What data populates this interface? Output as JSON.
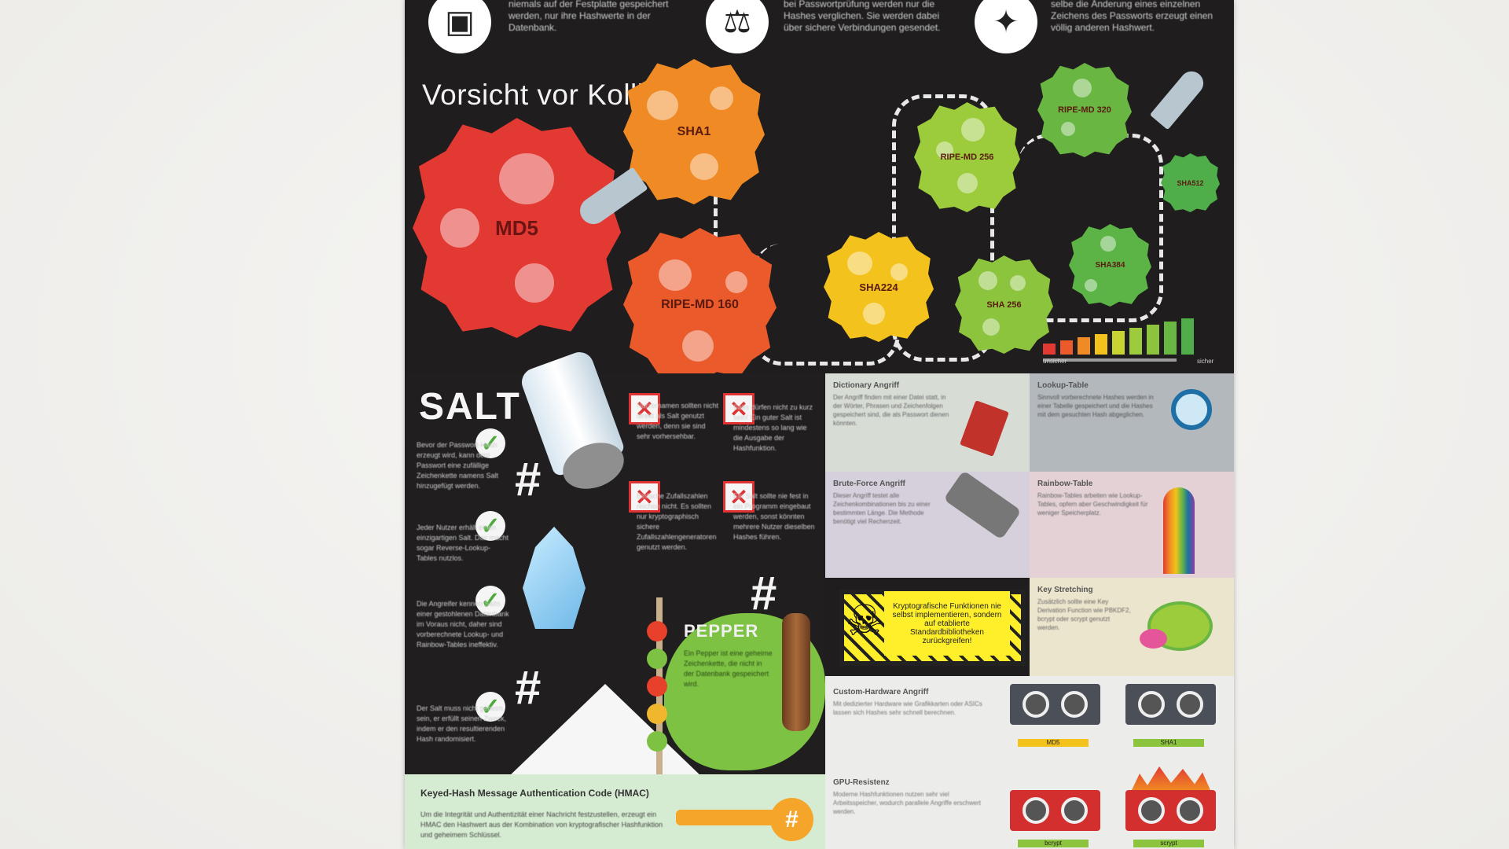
{
  "poster": {
    "section_title": "Vorsicht vor Kollisionen",
    "header_texts": [
      "niemals auf der Festplatte gespeichert werden, nur ihre Hashwerte in der Datenbank.",
      "bei Passwortprüfung werden nur die Hashes verglichen. Sie werden dabei über sichere Verbindungen gesendet.",
      "selbe die Änderung eines einzelnen Zeichens des Passworts erzeugt einen völlig anderen Hashwert."
    ],
    "header_icons": [
      "hard-drive-icon",
      "scales-icon",
      "stamp-icon"
    ],
    "hashes": [
      {
        "label": "MD5",
        "color": "#e23a33"
      },
      {
        "label": "SHA1",
        "color": "#f08a24"
      },
      {
        "label": "RIPE-MD 160",
        "color": "#ea5a2a"
      },
      {
        "label": "SHA224",
        "color": "#f3c21c"
      },
      {
        "label": "RIPE-MD 256",
        "color": "#9ccb3b"
      },
      {
        "label": "SHA 256",
        "color": "#8cc43d"
      },
      {
        "label": "RIPE-MD 320",
        "color": "#6ab643"
      },
      {
        "label": "SHA384",
        "color": "#5cb346"
      },
      {
        "label": "SHA512",
        "color": "#4fae4a"
      }
    ],
    "scale": {
      "left_label": "unsicher",
      "right_label": "sicher"
    },
    "salt": {
      "title": "SALT",
      "checks": [
        "Bevor der Passwort-Hash erzeugt wird, kann dem Passwort eine zufällige Zeichenkette namens Salt hinzugefügt werden.",
        "Jeder Nutzer erhält einen einzigartigen Salt. Das macht sogar Reverse-Lookup-Tables nutzlos.",
        "Die Angreifer kennen Salts einer gestohlenen Datenbank im Voraus nicht, daher sind vorberechnete Lookup- und Rainbow-Tables ineffektiv.",
        "Der Salt muss nicht geheim sein, er erfüllt seinen Zweck, indem er den resultierenden Hash randomisiert."
      ],
      "crosses": [
        "Nutzernamen sollten nicht direkt als Salt genutzt werden, denn sie sind sehr vorhersehbar.",
        "Salts dürfen nicht zu kurz sein! Ein guter Salt ist mindestens so lang wie die Ausgabe der Hashfunktion.",
        "Einfache Zufallszahlen reichen nicht. Es sollten nur kryptographisch sichere Zufallszahlengeneratoren genutzt werden.",
        "Ein Salt sollte nie fest in ein Programm eingebaut werden, sonst könnten mehrere Nutzer dieselben Hashes führen."
      ]
    },
    "pepper": {
      "title": "PEPPER",
      "text": "Ein Pepper ist eine geheime Zeichenkette, die nicht in der Datenbank gespeichert wird."
    },
    "hmac": {
      "title": "Keyed-Hash Message Authentication Code (HMAC)",
      "text": "Um die Integrität und Authentizität einer Nachricht festzustellen, erzeugt ein HMAC den Hashwert aus der Kombination von kryptografischer Hashfunktion und geheimem Schlüssel."
    },
    "attacks": [
      {
        "title": "Dictionary Angriff",
        "text": "Der Angriff finden mit einer Datei statt, in der Wörter, Phrasen und Zeichenfolgen gespeichert sind, die als Passwort dienen könnten.",
        "bg": "#d7dcd5"
      },
      {
        "title": "Lookup-Table",
        "text": "Sinnvoll vorberechnete Hashes werden in einer Tabelle gespeichert und die Hashes mit dem gesuchten Hash abgeglichen.",
        "bg": "#b3b8bd"
      },
      {
        "title": "Brute-Force Angriff",
        "text": "Dieser Angriff testet alle Zeichenkombinationen bis zu einer bestimmten Länge. Die Methode benötigt viel Rechenzeit.",
        "bg": "#d6cfdc"
      },
      {
        "title": "Rainbow-Table",
        "text": "Rainbow-Tables arbeiten wie Lookup-Tables, opfern aber Geschwindigkeit für weniger Speicherplatz.",
        "bg": "#e3d1d6"
      },
      {
        "title": "Key Stretching",
        "text": "Zusätzlich sollte eine Key Derivation Function wie PBKDF2, bcrypt oder scrypt genutzt werden.",
        "bg": "#ece5cd"
      },
      {
        "title": "Custom-Hardware Angriff",
        "text": "Mit dedizierter Hardware wie Grafikkarten oder ASICs lassen sich Hashes sehr schnell berechnen.",
        "bg": "#ececea"
      },
      {
        "title": "GPU-Resistenz",
        "text": "Moderne Hashfunktionen nutzen sehr viel Arbeitsspeicher, wodurch parallele Angriffe erschwert werden.",
        "bg": "#ececea"
      }
    ],
    "warning": "Kryptografische Funktionen nie selbst implementieren, sondern auf etablierte Standardbibliotheken zurückgreifen!",
    "gpu_labels": [
      "MD5",
      "SHA1",
      "bcrypt",
      "scrypt"
    ]
  }
}
